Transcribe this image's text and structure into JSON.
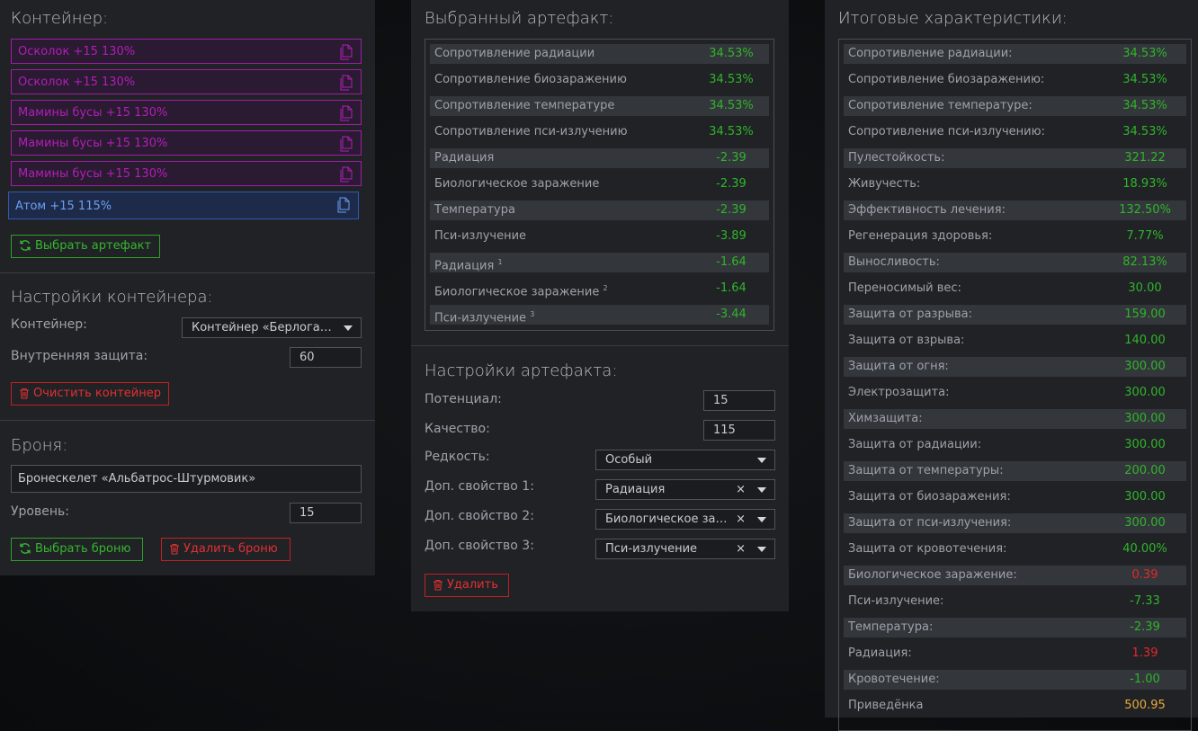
{
  "colors": {
    "green": "#30b52a",
    "red": "#e42828",
    "orange": "#e8a83a",
    "magenta": "#b21fb6",
    "blue": "#6aa0f0"
  },
  "container": {
    "title": "Контейнер:",
    "artifacts": [
      {
        "label": "Осколок +15 130%"
      },
      {
        "label": "Осколок +15 130%"
      },
      {
        "label": "Мамины бусы +15 130%"
      },
      {
        "label": "Мамины бусы +15 130%"
      },
      {
        "label": "Мамины бусы +15 130%"
      },
      {
        "label": "Атом +15 115%"
      }
    ],
    "select_artifact_button": "Выбрать артефакт"
  },
  "container_settings": {
    "title": "Настройки контейнера:",
    "container_label": "Контейнер:",
    "container_value": "Контейнер «Берлога…",
    "inner_protection_label": "Внутренняя защита:",
    "inner_protection_value": "60",
    "clear_button": "Очистить контейнер"
  },
  "armor": {
    "title": "Броня:",
    "armor_name": "Бронескелет «Альбатрос-Штурмовик»",
    "level_label": "Уровень:",
    "level_value": "15",
    "select_button": "Выбрать броню",
    "delete_button": "Удалить броню"
  },
  "selected_artifact": {
    "title": "Выбранный артефакт:",
    "rows": [
      {
        "name": "Сопротивление радиации",
        "sup": "",
        "value": "34.53%",
        "color": "green"
      },
      {
        "name": "Сопротивление биозаражению",
        "sup": "",
        "value": "34.53%",
        "color": "green"
      },
      {
        "name": "Сопротивление температуре",
        "sup": "",
        "value": "34.53%",
        "color": "green"
      },
      {
        "name": "Сопротивление пси-излучению",
        "sup": "",
        "value": "34.53%",
        "color": "green"
      },
      {
        "name": "Радиация",
        "sup": "",
        "value": "-2.39",
        "color": "green"
      },
      {
        "name": "Биологическое заражение",
        "sup": "",
        "value": "-2.39",
        "color": "green"
      },
      {
        "name": "Температура",
        "sup": "",
        "value": "-2.39",
        "color": "green"
      },
      {
        "name": "Пси-излучение",
        "sup": "",
        "value": "-3.89",
        "color": "green"
      },
      {
        "name": "Радиация",
        "sup": "1",
        "value": "-1.64",
        "color": "green"
      },
      {
        "name": "Биологическое заражение",
        "sup": "2",
        "value": "-1.64",
        "color": "green"
      },
      {
        "name": "Пси-излучение",
        "sup": "3",
        "value": "-3.44",
        "color": "green"
      }
    ]
  },
  "artifact_settings": {
    "title": "Настройки артефакта:",
    "potential_label": "Потенциал:",
    "potential_value": "15",
    "quality_label": "Качество:",
    "quality_value": "115",
    "rarity_label": "Редкость:",
    "rarity_value": "Особый",
    "extra1_label": "Доп. свойство 1:",
    "extra1_value": "Радиация",
    "extra2_label": "Доп. свойство 2:",
    "extra2_value": "Биологическое за…",
    "extra3_label": "Доп. свойство 3:",
    "extra3_value": "Пси-излучение",
    "clear_icon": "×",
    "delete_button": "Удалить"
  },
  "totals": {
    "title": "Итоговые характеристики:",
    "rows": [
      {
        "name": "Сопротивление радиации:",
        "value": "34.53%",
        "color": "green"
      },
      {
        "name": "Сопротивление биозаражению:",
        "value": "34.53%",
        "color": "green"
      },
      {
        "name": "Сопротивление температуре:",
        "value": "34.53%",
        "color": "green"
      },
      {
        "name": "Сопротивление пси-излучению:",
        "value": "34.53%",
        "color": "green"
      },
      {
        "name": "Пулестойкость:",
        "value": "321.22",
        "color": "green"
      },
      {
        "name": "Живучесть:",
        "value": "18.93%",
        "color": "green"
      },
      {
        "name": "Эффективность лечения:",
        "value": "132.50%",
        "color": "green"
      },
      {
        "name": "Регенерация здоровья:",
        "value": "7.77%",
        "color": "green"
      },
      {
        "name": "Выносливость:",
        "value": "82.13%",
        "color": "green"
      },
      {
        "name": "Переносимый вес:",
        "value": "30.00",
        "color": "green"
      },
      {
        "name": "Защита от разрыва:",
        "value": "159.00",
        "color": "green"
      },
      {
        "name": "Защита от взрыва:",
        "value": "140.00",
        "color": "green"
      },
      {
        "name": "Защита от огня:",
        "value": "300.00",
        "color": "green"
      },
      {
        "name": "Электрозащита:",
        "value": "300.00",
        "color": "green"
      },
      {
        "name": "Химзащита:",
        "value": "300.00",
        "color": "green"
      },
      {
        "name": "Защита от радиации:",
        "value": "300.00",
        "color": "green"
      },
      {
        "name": "Защита от температуры:",
        "value": "200.00",
        "color": "green"
      },
      {
        "name": "Защита от биозаражения:",
        "value": "300.00",
        "color": "green"
      },
      {
        "name": "Защита от пси-излучения:",
        "value": "300.00",
        "color": "green"
      },
      {
        "name": "Защита от кровотечения:",
        "value": "40.00%",
        "color": "green"
      },
      {
        "name": "Биологическое заражение:",
        "value": "0.39",
        "color": "red"
      },
      {
        "name": "Пси-излучение:",
        "value": "-7.33",
        "color": "green"
      },
      {
        "name": "Температура:",
        "value": "-2.39",
        "color": "green"
      },
      {
        "name": "Радиация:",
        "value": "1.39",
        "color": "red"
      },
      {
        "name": "Кровотечение:",
        "value": "-1.00",
        "color": "green"
      },
      {
        "name": "Приведёнка",
        "value": "500.95",
        "color": "orange"
      }
    ]
  }
}
